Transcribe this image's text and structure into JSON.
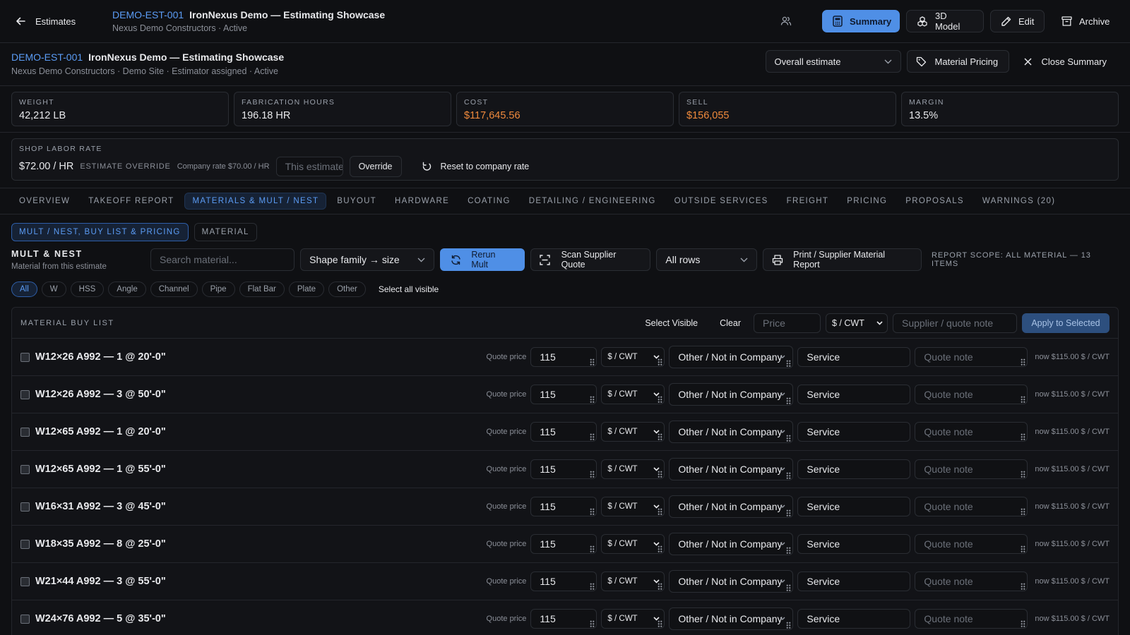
{
  "topbar": {
    "back_label": "Estimates",
    "estimate_id": "DEMO-EST-001",
    "estimate_name": "IronNexus Demo — Estimating Showcase",
    "subtitle": "Nexus Demo Constructors · Active",
    "buttons": {
      "summary": "Summary",
      "model": "3D Model",
      "edit": "Edit",
      "archive": "Archive"
    }
  },
  "summary": {
    "estimate_id": "DEMO-EST-001",
    "estimate_name": "IronNexus Demo — Estimating Showcase",
    "subtitle": "Nexus Demo Constructors · Demo Site · Estimator assigned · Active",
    "scope_select": "Overall estimate",
    "material_pricing": "Material Pricing",
    "close": "Close Summary"
  },
  "metrics": [
    {
      "label": "WEIGHT",
      "value": "42,212 LB",
      "color": "#e8e9ec"
    },
    {
      "label": "FABRICATION HOURS",
      "value": "196.18 HR",
      "color": "#e8e9ec"
    },
    {
      "label": "COST",
      "value": "$117,645.56",
      "color": "#f08a3c"
    },
    {
      "label": "SELL",
      "value": "$156,055",
      "color": "#f08a3c"
    },
    {
      "label": "MARGIN",
      "value": "13.5%",
      "color": "#e8e9ec"
    }
  ],
  "labor": {
    "label": "SHOP LABOR RATE",
    "rate": "$72.00 / HR",
    "override_tag": "ESTIMATE OVERRIDE",
    "company_rate": "Company rate $70.00 / HR",
    "input_placeholder": "This estimate rate",
    "override_button": "Override",
    "reset_button": "Reset to company rate"
  },
  "tabs": [
    "OVERVIEW",
    "TAKEOFF REPORT",
    "MATERIALS & MULT / NEST",
    "BUYOUT",
    "HARDWARE",
    "COATING",
    "DETAILING / ENGINEERING",
    "OUTSIDE SERVICES",
    "FREIGHT",
    "PRICING",
    "PROPOSALS",
    "WARNINGS (20)"
  ],
  "active_tab": 2,
  "subtabs": [
    "MULT / NEST, BUY LIST & PRICING",
    "MATERIAL"
  ],
  "mult": {
    "title": "MULT & NEST",
    "subtitle": "Material from this estimate",
    "search_placeholder": "Search material...",
    "shape_select": "Shape family → size",
    "rerun": "Rerun Mult",
    "scan": "Scan Supplier Quote",
    "rows_select": "All rows",
    "print": "Print / Supplier Material Report",
    "scope": "REPORT SCOPE: ALL MATERIAL — 13 ITEMS"
  },
  "filters": [
    "All",
    "W",
    "HSS",
    "Angle",
    "Channel",
    "Pipe",
    "Flat Bar",
    "Plate",
    "Other"
  ],
  "select_all_visible": "Select all visible",
  "buylist": {
    "label": "MATERIAL BUY LIST",
    "select_visible": "Select Visible",
    "clear": "Clear",
    "price_placeholder": "Price",
    "unit": "$ / CWT",
    "supplier_placeholder": "Supplier / quote note",
    "apply": "Apply to Selected",
    "rows": [
      {
        "name": "W12×26 A992 — 1 @ 20'-0\"",
        "quote_label": "Quote price",
        "price": "115",
        "unit": "$ / CWT",
        "supplier": "Other / Not in Company",
        "service": "Service",
        "note_placeholder": "Quote note",
        "now": "now $115.00 $ / CWT"
      },
      {
        "name": "W12×26 A992 — 3 @ 50'-0\"",
        "quote_label": "Quote price",
        "price": "115",
        "unit": "$ / CWT",
        "supplier": "Other / Not in Company",
        "service": "Service",
        "note_placeholder": "Quote note",
        "now": "now $115.00 $ / CWT"
      },
      {
        "name": "W12×65 A992 — 1 @ 20'-0\"",
        "quote_label": "Quote price",
        "price": "115",
        "unit": "$ / CWT",
        "supplier": "Other / Not in Company",
        "service": "Service",
        "note_placeholder": "Quote note",
        "now": "now $115.00 $ / CWT"
      },
      {
        "name": "W12×65 A992 — 1 @ 55'-0\"",
        "quote_label": "Quote price",
        "price": "115",
        "unit": "$ / CWT",
        "supplier": "Other / Not in Company",
        "service": "Service",
        "note_placeholder": "Quote note",
        "now": "now $115.00 $ / CWT"
      },
      {
        "name": "W16×31 A992 — 3 @ 45'-0\"",
        "quote_label": "Quote price",
        "price": "115",
        "unit": "$ / CWT",
        "supplier": "Other / Not in Company",
        "service": "Service",
        "note_placeholder": "Quote note",
        "now": "now $115.00 $ / CWT"
      },
      {
        "name": "W18×35 A992 — 8 @ 25'-0\"",
        "quote_label": "Quote price",
        "price": "115",
        "unit": "$ / CWT",
        "supplier": "Other / Not in Company",
        "service": "Service",
        "note_placeholder": "Quote note",
        "now": "now $115.00 $ / CWT"
      },
      {
        "name": "W21×44 A992 — 3 @ 55'-0\"",
        "quote_label": "Quote price",
        "price": "115",
        "unit": "$ / CWT",
        "supplier": "Other / Not in Company",
        "service": "Service",
        "note_placeholder": "Quote note",
        "now": "now $115.00 $ / CWT"
      },
      {
        "name": "W24×76 A992 — 5 @ 35'-0\"",
        "quote_label": "Quote price",
        "price": "115",
        "unit": "$ / CWT",
        "supplier": "Other / Not in Company",
        "service": "Service",
        "note_placeholder": "Quote note",
        "now": "now $115.00 $ / CWT"
      }
    ]
  },
  "colors": {
    "accent": "#5b9cf5",
    "primary_button": "#4f8fe6",
    "money": "#f08a3c",
    "background": "#0f1013"
  }
}
